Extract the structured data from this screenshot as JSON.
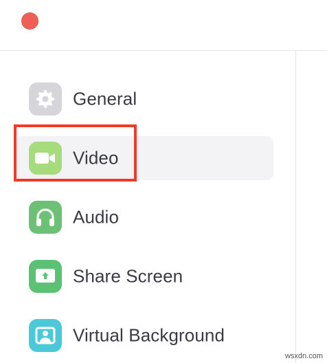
{
  "window": {
    "close_color": "#f05f57"
  },
  "sidebar": {
    "items": [
      {
        "label": "General",
        "icon": "gear-icon",
        "color": "#d6d6da",
        "selected": false
      },
      {
        "label": "Video",
        "icon": "video-camera-icon",
        "color": "#a6dc7c",
        "selected": true
      },
      {
        "label": "Audio",
        "icon": "headphones-icon",
        "color": "#6cc176",
        "selected": false
      },
      {
        "label": "Share Screen",
        "icon": "share-screen-icon",
        "color": "#5bc274",
        "selected": false
      },
      {
        "label": "Virtual Background",
        "icon": "virtual-background-icon",
        "color": "#4cc9d8",
        "selected": false
      }
    ]
  },
  "annotation": {
    "highlight_color": "#f13a27"
  },
  "watermark": {
    "text": "wsxdn.com"
  }
}
